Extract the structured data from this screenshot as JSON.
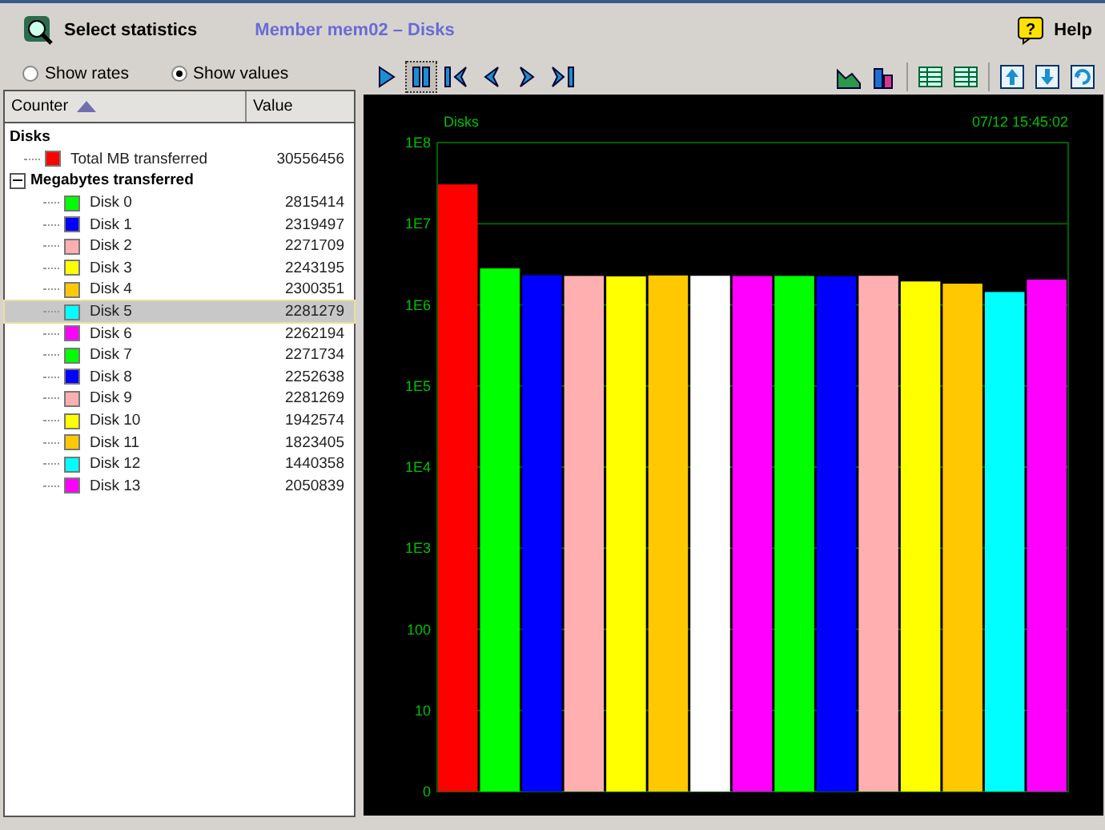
{
  "header": {
    "title": "Select statistics",
    "subtitle": "Member mem02 – Disks",
    "help": "Help",
    "help_icon": "?"
  },
  "display_mode": [
    {
      "label": "Show rates",
      "selected": false
    },
    {
      "label": "Show values",
      "selected": true
    }
  ],
  "table": {
    "columns": [
      {
        "label": "Counter",
        "sorted": true
      },
      {
        "label": "Value",
        "sorted": false
      }
    ]
  },
  "tree": [
    {
      "label": "Disks",
      "children": [
        {
          "label": "Total MB transferred",
          "value": "30556456",
          "color": "#ff0000",
          "selected": false
        }
      ]
    },
    {
      "label": "Megabytes transferred",
      "expanded": true,
      "children": [
        {
          "label": "Disk 0",
          "value": "2815414",
          "color": "#00ff00",
          "selected": false
        },
        {
          "label": "Disk 1",
          "value": "2319497",
          "color": "#0000ff",
          "selected": false
        },
        {
          "label": "Disk 2",
          "value": "2271709",
          "color": "#ffafaf",
          "selected": false
        },
        {
          "label": "Disk 3",
          "value": "2243195",
          "color": "#ffff00",
          "selected": false
        },
        {
          "label": "Disk 4",
          "value": "2300351",
          "color": "#ffc800",
          "selected": false
        },
        {
          "label": "Disk 5",
          "value": "2281279",
          "color": "#00ffff",
          "selected": true
        },
        {
          "label": "Disk 6",
          "value": "2262194",
          "color": "#ff00ff",
          "selected": false
        },
        {
          "label": "Disk 7",
          "value": "2271734",
          "color": "#00ff00",
          "selected": false
        },
        {
          "label": "Disk 8",
          "value": "2252638",
          "color": "#0000ff",
          "selected": false
        },
        {
          "label": "Disk 9",
          "value": "2281269",
          "color": "#ffafaf",
          "selected": false
        },
        {
          "label": "Disk 10",
          "value": "1942574",
          "color": "#ffff00",
          "selected": false
        },
        {
          "label": "Disk 11",
          "value": "1823405",
          "color": "#ffc800",
          "selected": false
        },
        {
          "label": "Disk 12",
          "value": "1440358",
          "color": "#00ffff",
          "selected": false
        },
        {
          "label": "Disk 13",
          "value": "2050839",
          "color": "#ff00ff",
          "selected": false
        }
      ]
    }
  ],
  "playback_controls": [
    {
      "selected": false
    },
    {
      "selected": true
    },
    {
      "selected": false
    },
    {
      "selected": false
    },
    {
      "selected": false
    },
    {
      "selected": false
    }
  ],
  "chart": {
    "title": "Disks",
    "timestamp": "07/12 15:45:02",
    "y_axis_labels": [
      "1E8",
      "1E7",
      "1E6",
      "1E5",
      "1E4",
      "1E3",
      "100",
      "10",
      "0"
    ]
  }
}
